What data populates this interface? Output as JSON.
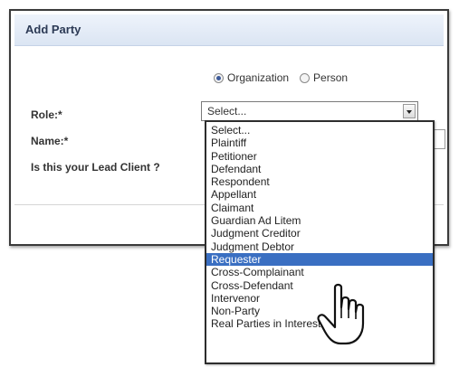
{
  "dialog": {
    "title": "Add Party",
    "party_type": {
      "options": [
        "Organization",
        "Person"
      ],
      "selected": "Organization"
    },
    "labels": {
      "role": "Role:*",
      "name": "Name:*",
      "lead_client": "Is this your Lead Client ?"
    },
    "role_select": {
      "value": "Select..."
    }
  },
  "role_dropdown": {
    "highlighted": "Requester",
    "options": [
      "Select...",
      "Plaintiff",
      "Petitioner",
      "Defendant",
      "Respondent",
      "Appellant",
      "Claimant",
      "Guardian Ad Litem",
      "Judgment Creditor",
      "Judgment Debtor",
      "Requester",
      "Cross-Complainant",
      "Cross-Defendant",
      "Intervenor",
      "Non-Party",
      "Real Parties in Interest"
    ]
  },
  "colors": {
    "header_bg": "#dbe5f3",
    "highlight": "#3a6fc2"
  },
  "icons": {
    "cursor": "hand-pointer-icon"
  }
}
